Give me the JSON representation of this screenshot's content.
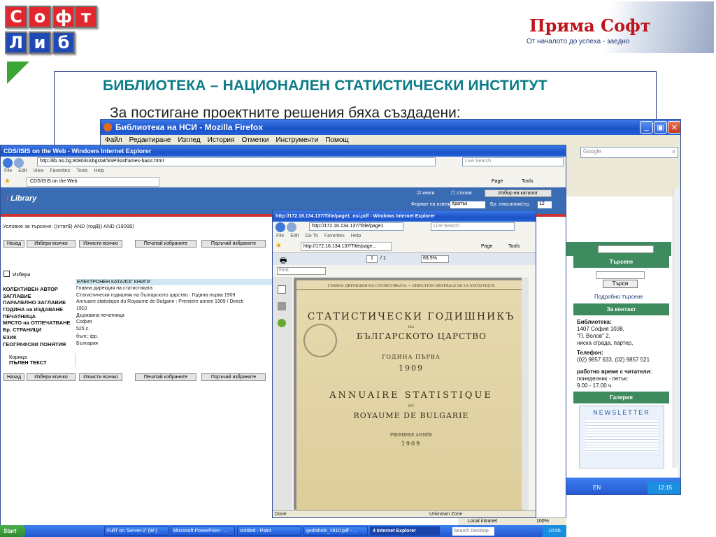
{
  "slide": {
    "title": "БИБЛИОТЕКА – НАЦИОНАЛЕН СТАТИСТИЧЕСКИ ИНСТИТУТ",
    "subtitle": "За постигане проектните решения бяха създадени:"
  },
  "logo_left": {
    "tiles_top": [
      "С",
      "о",
      "ф",
      "т"
    ],
    "tiles_bottom": [
      "Л",
      "и",
      "б"
    ]
  },
  "logo_right": {
    "name": "Прима Софт",
    "slogan": "От началото до успеха - заедно"
  },
  "firefox": {
    "title": "Библиотека на НСИ - Mozilla Firefox",
    "menu": [
      "Файл",
      "Редактиране",
      "Изглед",
      "История",
      "Отметки",
      "Инструменти",
      "Помощ"
    ],
    "search_placeholder": "Google",
    "side": {
      "search_head": "Търсене",
      "search_button": "Търси",
      "advanced": "Подробно търсене",
      "contact_head": "За контакт",
      "library_label": "Библиотека:",
      "addr1": "1407 София 1038,",
      "addr2": "\"П. Волов\" 2,",
      "addr3": "ниска сграда, партер,",
      "phone_label": "Телефон:",
      "phone": "(02) 9857 633, (02) 9857 521",
      "hours_label": "работно време с читатели:",
      "hours_days": "понеделник - петък:",
      "hours": "9.00 - 17.00 ч.",
      "gallery_head": "Галерия",
      "newsletter": "NEWSLETTER"
    },
    "tray_lang": "EN",
    "tray_time": "12:15"
  },
  "ie1": {
    "title": "CDS/ISIS on the Web - Windows Internet Explorer",
    "url": "http://lib.nsi.bg:8080/isisbgstat/SSP/isisframes-basic.html",
    "search_placeholder": "Live Search",
    "menu": [
      "File",
      "Edit",
      "View",
      "Favorites",
      "Tools",
      "Help"
    ],
    "tab": "CDS/ISIS on the Web",
    "page_label": "Page",
    "tools_label": "Tools",
    "brand": "Library",
    "check_books": "книги",
    "check_articles": "статии",
    "catalog_button": "Избор на каталог",
    "format_label": "Формат на извеждане",
    "format_value": "Кратък",
    "per_page_label": "Бр. описания/стр.",
    "per_page_value": "12",
    "query": "Условие за търсене: ((стат$) AND (год$)) AND (1909$)",
    "buttons": [
      "Назад",
      "Избери всичко",
      "Изчисти всичко",
      "Печатай избраните",
      "Поръчай избраните"
    ],
    "select_label": "Избери",
    "catalog_title": "ЕЛЕКТРОНЕН КАТАЛОГ КНИГИ",
    "rows": [
      {
        "label": "КОЛЕКТИВЕН АВТОР",
        "value": "Главна дирекция на статистиката"
      },
      {
        "label": "ЗАГЛАВИЕ",
        "value": "Статистически годишник на българското царство : Година първа 1909"
      },
      {
        "label": "ПАРАЛЕЛНО ЗАГЛАВИЕ",
        "value": "Annuaire statistique du Royaume de Bulgarie : Premiere annee 1909 / Directi"
      },
      {
        "label": "ГОДИНА на ИЗДАВАНЕ",
        "value": "1910"
      },
      {
        "label": "ПЕЧАТНИЦА",
        "value": "Държавна печатница"
      },
      {
        "label": "МЯСТО на ОТПЕЧАТВАНЕ",
        "value": "София"
      },
      {
        "label": "Бр. СТРАНИЦИ",
        "value": "525 с."
      },
      {
        "label": "ЕЗИК",
        "value": "бълг.; фр."
      },
      {
        "label": "ГЕОГРАФСКИ ПОНЯТИЯ",
        "value": "България"
      }
    ],
    "cover_label": "Корица",
    "fulltext_label": "ПЪЛЕН ТЕКСТ"
  },
  "ie2": {
    "title": "http://172.16.134.137/Title/page1_nsi.pdf - Windows Internet Explorer",
    "url": "http://172.16.134.137/Title/page1",
    "search_placeholder": "Live Search",
    "menu": [
      "File",
      "Edit",
      "Go To",
      "Favorites",
      "Help"
    ],
    "tab": "http://172.16.134.137/Title/page...",
    "page_label": "Page",
    "tools_label": "Tools",
    "page_num": "1",
    "page_total": "/ 1",
    "zoom": "69,5%",
    "find_placeholder": "Find",
    "status_done": "Done",
    "status_zone": "Unknown Zone",
    "doc": {
      "header": "ГЛАВНА ДИРЕКЦИЯ НА СТАТИСТИКАТА  —  DIRECTION GÉNÉRALE DE LA STATISTIQUE",
      "title1": "СТАТИСТИЧЕСКИ ГОДИШНИКЪ",
      "na": "НА",
      "title2": "БЪЛГАРСКОТО ЦАРСТВО",
      "year_label": "ГОДИНА ПЪРВА",
      "year": "1909",
      "fr1": "ANNUAIRE STATISTIQUE",
      "du": "DU",
      "fr2": "ROYAUME DE BULGARIE",
      "fr_year_label": "PREMIERE ANNÉE",
      "fr_year": "1909"
    }
  },
  "status_right": {
    "zone": "Local intranet",
    "zoom": "100%"
  },
  "taskbar": {
    "start": "Start",
    "items": [
      "FullT on 'Server-2' (W:)",
      "Microsoft PowerPoint - ...",
      "untitled - Paint",
      "godishnik_1910.pdf - ...",
      "4 Internet Explorer"
    ],
    "search": "Search Desktop",
    "time": "10:56"
  }
}
